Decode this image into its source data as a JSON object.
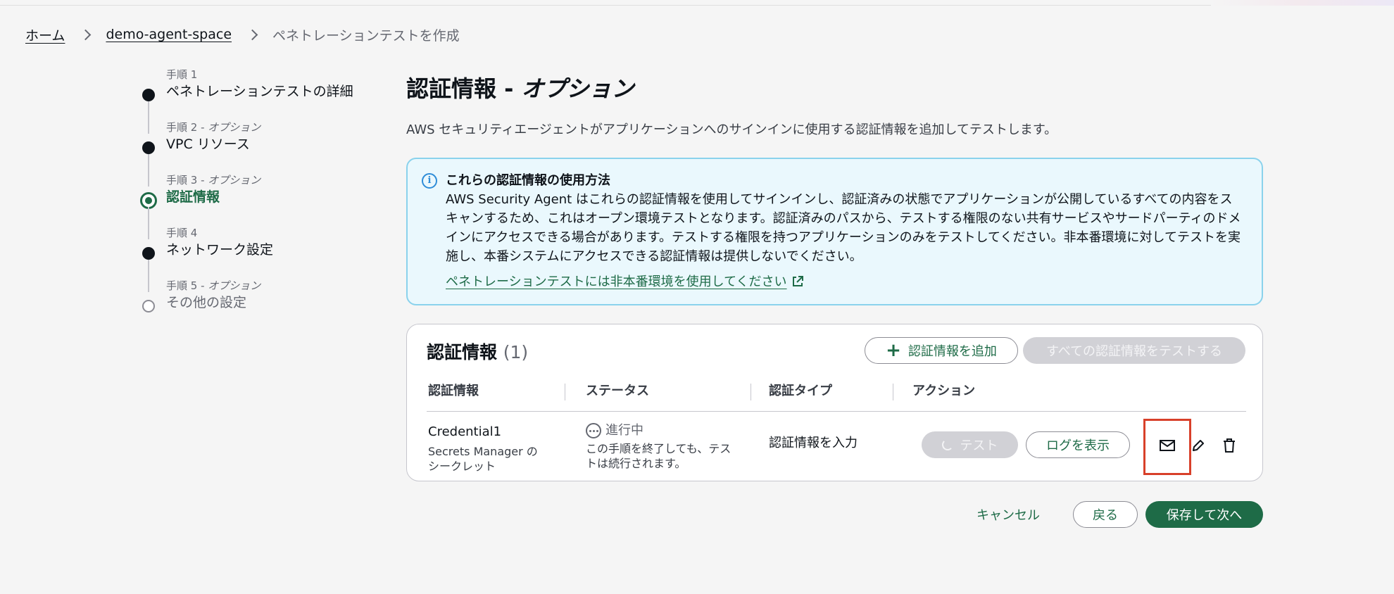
{
  "breadcrumb": {
    "home": "ホーム",
    "space": "demo-agent-space",
    "current": "ペネトレーションテストを作成"
  },
  "steps": [
    {
      "num": "手順 1",
      "optional": "",
      "title": "ペネトレーションテストの詳細",
      "state": "done"
    },
    {
      "num": "手順 2 - ",
      "optional": "オプション",
      "title": "VPC リソース",
      "state": "done"
    },
    {
      "num": "手順 3 - ",
      "optional": "オプション",
      "title": "認証情報",
      "state": "current"
    },
    {
      "num": "手順 4",
      "optional": "",
      "title": "ネットワーク設定",
      "state": "done"
    },
    {
      "num": "手順 5 - ",
      "optional": "オプション",
      "title": "その他の設定",
      "state": "future"
    }
  ],
  "main": {
    "title": "認証情報 - ",
    "title_optional": "オプション",
    "description": "AWS セキュリティエージェントがアプリケーションへのサインインに使用する認証情報を追加してテストします。"
  },
  "info": {
    "title": "これらの認証情報の使用方法",
    "body": "AWS Security Agent はこれらの認証情報を使用してサインインし、認証済みの状態でアプリケーションが公開しているすべての内容をスキャンするため、これはオープン環境テストとなります。認証済みのパスから、テストする権限のない共有サービスやサードパーティのドメインにアクセスできる場合があります。テストする権限を持つアプリケーションのみをテストしてください。非本番環境に対してテストを実施し、本番システムにアクセスできる認証情報は提供しないでください。",
    "link": "ペネトレーションテストには非本番環境を使用してください",
    "accent": "#8ad2ec"
  },
  "credentials": {
    "title": "認証情報",
    "count": "(1)",
    "add_button": "認証情報を追加",
    "test_all_button": "すべての認証情報をテストする",
    "columns": [
      "認証情報",
      "ステータス",
      "認証タイプ",
      "アクション"
    ],
    "rows": [
      {
        "name": "Credential1",
        "name_sub": "Secrets Manager のシークレット",
        "status": "進行中",
        "status_sub": "この手順を終了しても、テストは続行されます。",
        "auth_type": "認証情報を入力",
        "test_button": "テスト",
        "logs_button": "ログを表示"
      }
    ]
  },
  "footer": {
    "cancel": "キャンセル",
    "back": "戻る",
    "next": "保存して次へ",
    "primary_color": "#1e6b47"
  }
}
